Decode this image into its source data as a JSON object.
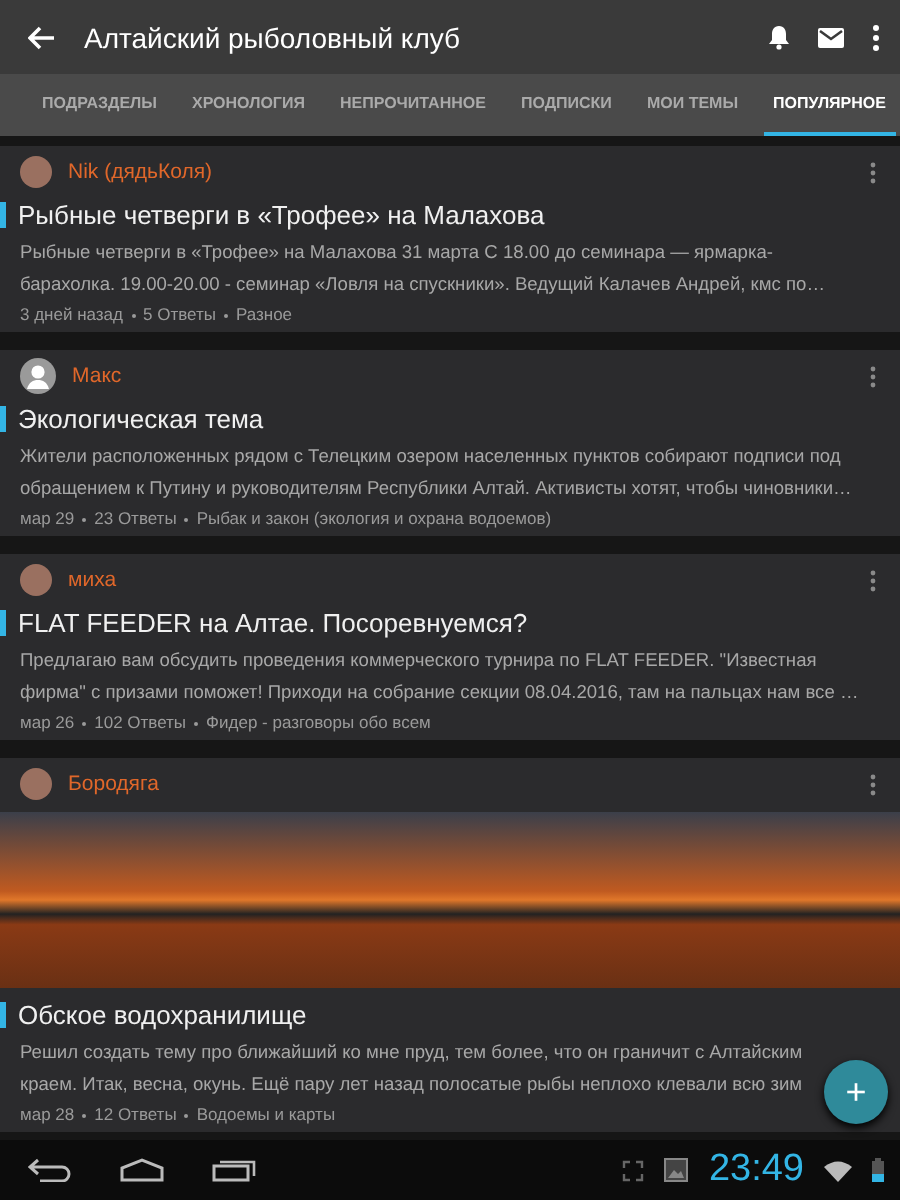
{
  "app_bar": {
    "title": "Алтайский рыболовный клуб"
  },
  "tabs": [
    {
      "label": "ПОДРАЗДЕЛЫ",
      "selected": false
    },
    {
      "label": "ХРОНОЛОГИЯ",
      "selected": false
    },
    {
      "label": "НЕПРОЧИТАННОЕ",
      "selected": false
    },
    {
      "label": "ПОДПИСКИ",
      "selected": false
    },
    {
      "label": "МОИ ТЕМЫ",
      "selected": false
    },
    {
      "label": "ПОПУЛЯРНОЕ",
      "selected": true
    }
  ],
  "topics": [
    {
      "author": "Nik  (дядьКоля)",
      "avatar_silhouette": false,
      "title": "Рыбные четверги в «Трофее» на Малахова",
      "excerpt_lines": [
        "Рыбные четверги в «Трофее» на Малахова 31 марта С 18.00 до семинара — ярмарка-",
        "барахолка. 19.00-20.00 - семинар «Ловля на спускники». Ведущий Калачев Андрей, кмс по…"
      ],
      "date": "3 дней назад",
      "replies": "5 Ответы",
      "forum": "Разное",
      "image": false
    },
    {
      "author": "Макс",
      "avatar_silhouette": true,
      "title": "Экологическая тема",
      "excerpt_lines": [
        "Жители расположенных рядом с Телецким озером населенных пунктов собирают подписи под",
        "обращением к Путину и руководителям Республики Алтай. Активисты хотят, чтобы чиновники…"
      ],
      "date": "мар 29",
      "replies": "23 Ответы",
      "forum": "Рыбак и закон (экология и охрана водоемов)",
      "image": false
    },
    {
      "author": "миха",
      "avatar_silhouette": false,
      "title": "FLAT FEEDER на Алтае. Посоревнуемся?",
      "excerpt_lines": [
        "Предлагаю вам обсудить проведения коммерческого турнира по FLAT FEEDER. \"Известная",
        "фирма\" с призами поможет! Приходи на собрание секции 08.04.2016, там на пальцах нам все …"
      ],
      "date": "мар 26",
      "replies": "102 Ответы",
      "forum": "Фидер - разговоры обо всем",
      "image": false
    },
    {
      "author": "Бородяга",
      "avatar_silhouette": false,
      "title": "Обское водохранилище",
      "excerpt_lines": [
        "Решил создать тему про ближайший ко мне пруд, тем более, что он граничит с Алтайским",
        "краем. Итак, весна, окунь. Ещё пару лет назад полосатые рыбы неплохо клевали всю зим"
      ],
      "date": "мар 28",
      "replies": "12 Ответы",
      "forum": "Водоемы и карты",
      "image": true
    }
  ],
  "fab": {
    "label": "+"
  },
  "nav_bar": {
    "time": "23:49"
  }
}
